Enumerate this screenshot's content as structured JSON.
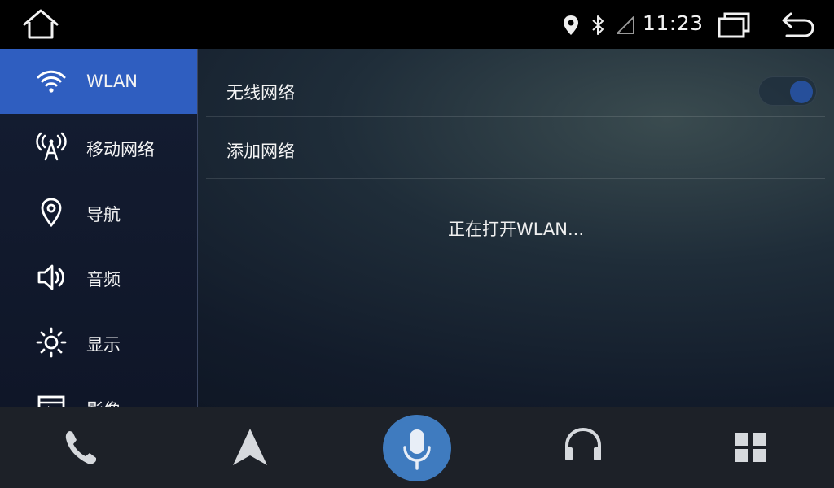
{
  "status_bar": {
    "time": "11:23"
  },
  "sidebar": {
    "items": [
      {
        "label": "WLAN",
        "icon": "wifi-icon",
        "active": true
      },
      {
        "label": "移动网络",
        "icon": "cell-tower-icon",
        "active": false
      },
      {
        "label": "导航",
        "icon": "location-pin-icon",
        "active": false
      },
      {
        "label": "音频",
        "icon": "speaker-icon",
        "active": false
      },
      {
        "label": "显示",
        "icon": "brightness-icon",
        "active": false
      },
      {
        "label": "影像",
        "icon": "video-icon",
        "active": false
      }
    ]
  },
  "main": {
    "wireless_label": "无线网络",
    "wireless_toggle_on": true,
    "add_network_label": "添加网络",
    "status_message": "正在打开WLAN..."
  },
  "dock": {
    "items": [
      "phone-icon",
      "navigation-arrow-icon",
      "microphone-icon",
      "headphones-icon",
      "apps-grid-icon"
    ]
  },
  "colors": {
    "accent": "#2f5ec0",
    "mic_button": "#3f7bbf",
    "dock_bg": "#1d2128"
  }
}
